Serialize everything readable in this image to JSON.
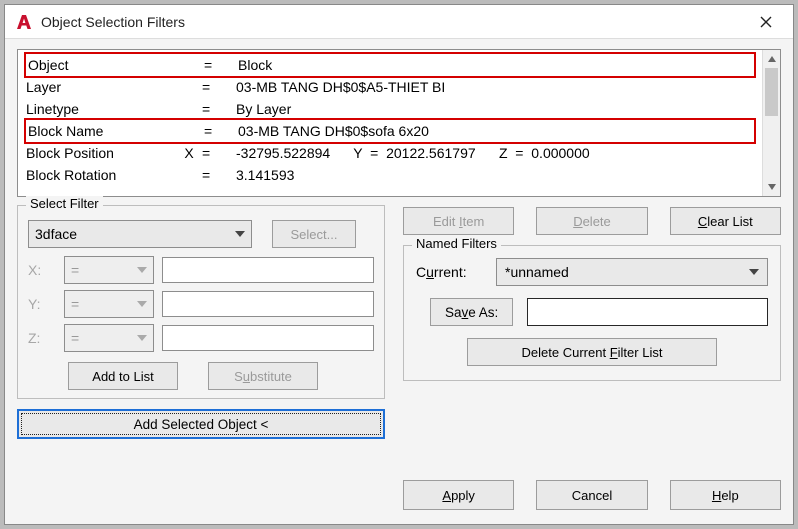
{
  "title": "Object Selection Filters",
  "list": {
    "rows": [
      {
        "name": "Object",
        "ch": "",
        "op": "=",
        "value": "Block",
        "hl": true
      },
      {
        "name": "Layer",
        "ch": "",
        "op": "=",
        "value": "03-MB TANG DH$0$A5-THIET BI",
        "hl": false
      },
      {
        "name": "Linetype",
        "ch": "",
        "op": "=",
        "value": "By Layer",
        "hl": false
      },
      {
        "name": "Block Name",
        "ch": "",
        "op": "=",
        "value": "03-MB TANG DH$0$sofa 6x20",
        "hl": true
      },
      {
        "name": "Block Position",
        "ch": "X",
        "op": "=",
        "value": "-32795.522894      Y  =  20122.561797      Z  =  0.000000",
        "hl": false
      },
      {
        "name": "Block Rotation",
        "ch": "",
        "op": "=",
        "value": "3.141593",
        "hl": false
      }
    ]
  },
  "selectFilter": {
    "legend": "Select Filter",
    "type": "3dface",
    "selectBtn": "Select...",
    "xLabel": "X:",
    "yLabel": "Y:",
    "zLabel": "Z:",
    "opX": "=",
    "opY": "=",
    "opZ": "=",
    "valX": "",
    "valY": "",
    "valZ": "",
    "addToList": "Add to List",
    "substitute": "Substitute",
    "addSelected": "Add Selected Object <"
  },
  "rightTop": {
    "editItem": "Edit Item",
    "delete": "Delete",
    "clearList": "Clear List"
  },
  "namedFilters": {
    "legend": "Named Filters",
    "currentLabel": "Current:",
    "current": "*unnamed",
    "saveAs": "Save As:",
    "saveAsValue": "",
    "deleteCurrent": "Delete Current Filter List"
  },
  "bottom": {
    "apply": "Apply",
    "cancel": "Cancel",
    "help": "Help"
  }
}
